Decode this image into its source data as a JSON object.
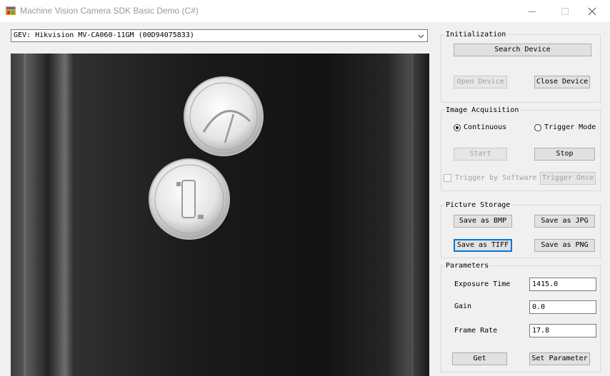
{
  "window": {
    "title": "Machine Vision Camera SDK Basic Demo (C#)",
    "icon": "app-icon",
    "controls": [
      "minimize-icon",
      "maximize-icon",
      "close-icon"
    ]
  },
  "device_select": {
    "value": "GEV: Hikvision MV-CA060-11GM (00D94075833)"
  },
  "initialization": {
    "title": "Initialization",
    "search_device": "Search Device",
    "open_device": "Open Device",
    "close_device": "Close Device"
  },
  "image_acquisition": {
    "title": "Image Acquisition",
    "continuous": "Continuous",
    "trigger_mode": "Trigger Mode",
    "selected_mode": "Continuous",
    "start": "Start",
    "stop": "Stop",
    "trigger_by_software": "Trigger by Software",
    "trigger_once": "Trigger Once"
  },
  "picture_storage": {
    "title": "Picture Storage",
    "save_bmp": "Save as BMP",
    "save_jpg": "Save as JPG",
    "save_tiff": "Save as TIFF",
    "save_png": "Save as PNG"
  },
  "parameters": {
    "title": "Parameters",
    "exposure_label": "Exposure Time",
    "exposure_value": "1415.0",
    "gain_label": "Gain",
    "gain_value": "0.0",
    "frame_rate_label": "Frame Rate",
    "frame_rate_value": "17.8",
    "get": "Get",
    "set_parameter": "Set Parameter"
  }
}
